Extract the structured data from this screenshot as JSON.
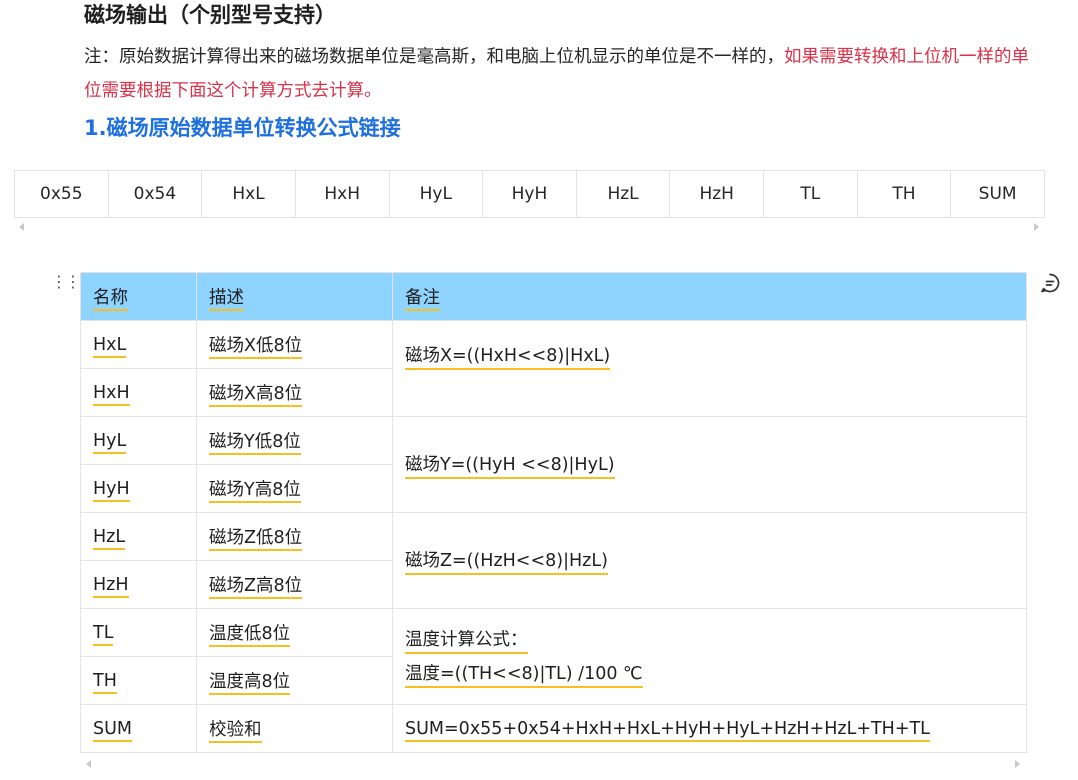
{
  "heading": "磁场输出（个别型号支持）",
  "note": {
    "text": "注：原始数据计算得出来的磁场数据单位是毫高斯，和电脑上位机显示的单位是不一样的，",
    "highlight": "如果需要转换和上位机一样的单位需要根据下面这个计算方式去计算。"
  },
  "subheading": "1.磁场原始数据单位转换公式链接",
  "packet": [
    "0x55",
    "0x54",
    "HxL",
    "HxH",
    "HyL",
    "HyH",
    "HzL",
    "HzH",
    "TL",
    "TH",
    "SUM"
  ],
  "table": {
    "headers": [
      "名称",
      "描述",
      "备注"
    ],
    "rows": [
      {
        "name": "HxL",
        "desc": "磁场X低8位"
      },
      {
        "name": "HxH",
        "desc": "磁场X高8位"
      },
      {
        "name": "HyL",
        "desc": "磁场Y低8位"
      },
      {
        "name": "HyH",
        "desc": "磁场Y高8位"
      },
      {
        "name": "HzL",
        "desc": "磁场Z低8位"
      },
      {
        "name": "HzH",
        "desc": "磁场Z高8位"
      },
      {
        "name": "TL",
        "desc": "温度低8位"
      },
      {
        "name": "TH",
        "desc": "温度高8位"
      },
      {
        "name": "SUM",
        "desc": "校验和"
      }
    ],
    "remarks": {
      "x": "磁场X=((HxH<<8)|HxL)",
      "y": "磁场Y=((HyH <<8)|HyL)",
      "z": "磁场Z=((HzH<<8)|HzL)",
      "temp_title": "温度计算公式：",
      "temp_formula": "温度=((TH<<8)|TL) /100 ℃",
      "sum": "SUM=0x55+0x54+HxH+HxL+HyH+HyL+HzH+HzL+TH+TL"
    }
  },
  "icons": {
    "drag": "drag-handle-icon",
    "comment": "comment-icon"
  },
  "colors": {
    "header_bg": "#8fd3ff",
    "link": "#1e6fe0",
    "highlight": "#d9324a",
    "underline": "#f6c024"
  }
}
